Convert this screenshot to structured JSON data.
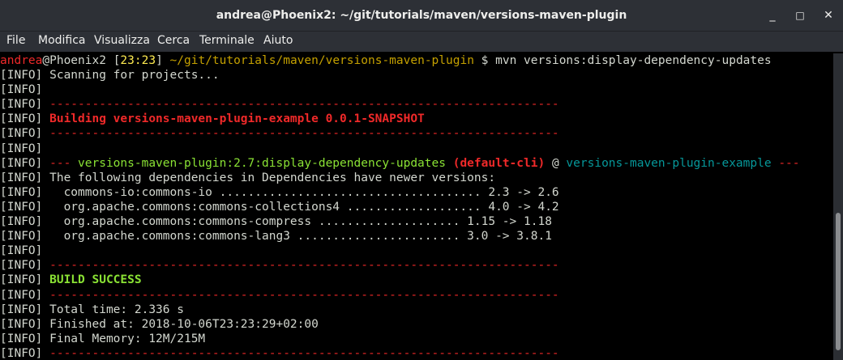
{
  "window": {
    "title": "andrea@Phoenix2: ~/git/tutorials/maven/versions-maven-plugin",
    "minimize_glyph": "_",
    "maximize_glyph": "□",
    "close_glyph": "✕"
  },
  "menu": [
    "File",
    "Modifica",
    "Visualizza",
    "Cerca",
    "Terminale",
    "Aiuto"
  ],
  "terminal": {
    "lines": [
      [
        [
          "red",
          "andrea"
        ],
        [
          "white",
          "@Phoenix2 ["
        ],
        [
          "yellow",
          "23:23"
        ],
        [
          "white",
          "] "
        ],
        [
          "orange",
          "~/git/tutorials/maven/versions-maven-plugin"
        ],
        [
          "white",
          " $ mvn versions:display-dependency-updates"
        ]
      ],
      [
        [
          "white",
          "[INFO] Scanning for projects..."
        ]
      ],
      [
        [
          "white",
          "[INFO]"
        ]
      ],
      [
        [
          "white",
          "[INFO] "
        ],
        [
          "red",
          "------------------------------------------------------------------------"
        ]
      ],
      [
        [
          "white",
          "[INFO] "
        ],
        [
          "redb",
          "Building versions-maven-plugin-example 0.0.1-SNAPSHOT"
        ]
      ],
      [
        [
          "white",
          "[INFO] "
        ],
        [
          "red",
          "------------------------------------------------------------------------"
        ]
      ],
      [
        [
          "white",
          "[INFO]"
        ]
      ],
      [
        [
          "white",
          "[INFO] "
        ],
        [
          "red",
          "--- "
        ],
        [
          "green",
          "versions-maven-plugin:2.7:display-dependency-updates"
        ],
        [
          "white",
          " "
        ],
        [
          "redb",
          "(default-cli)"
        ],
        [
          "white",
          " @ "
        ],
        [
          "teal",
          "versions-maven-plugin-example"
        ],
        [
          "red",
          " ---"
        ]
      ],
      [
        [
          "white",
          "[INFO] The following dependencies in Dependencies have newer versions:"
        ]
      ],
      [
        [
          "white",
          "[INFO]   commons-io:commons-io ..................................... 2.3 -> 2.6"
        ]
      ],
      [
        [
          "white",
          "[INFO]   org.apache.commons:commons-collections4 ................... 4.0 -> 4.2"
        ]
      ],
      [
        [
          "white",
          "[INFO]   org.apache.commons:commons-compress .................... 1.15 -> 1.18"
        ]
      ],
      [
        [
          "white",
          "[INFO]   org.apache.commons:commons-lang3 ....................... 3.0 -> 3.8.1"
        ]
      ],
      [
        [
          "white",
          "[INFO]"
        ]
      ],
      [
        [
          "white",
          "[INFO] "
        ],
        [
          "red",
          "------------------------------------------------------------------------"
        ]
      ],
      [
        [
          "white",
          "[INFO] "
        ],
        [
          "greenb",
          "BUILD SUCCESS"
        ]
      ],
      [
        [
          "white",
          "[INFO] "
        ],
        [
          "red",
          "------------------------------------------------------------------------"
        ]
      ],
      [
        [
          "white",
          "[INFO] Total time: 2.336 s"
        ]
      ],
      [
        [
          "white",
          "[INFO] Finished at: 2018-10-06T23:23:29+02:00"
        ]
      ],
      [
        [
          "white",
          "[INFO] Final Memory: 12M/215M"
        ]
      ],
      [
        [
          "white",
          "[INFO] "
        ],
        [
          "red",
          "------------------------------------------------------------------------"
        ]
      ]
    ]
  },
  "colors": {
    "titlebar": "#2d3036",
    "terminal_bg": "#000000",
    "text": "#d3d7cf",
    "red": "#ef2929",
    "green": "#8ae234",
    "yellow": "#fce94f",
    "orange": "#c4a000",
    "teal": "#06989a"
  }
}
